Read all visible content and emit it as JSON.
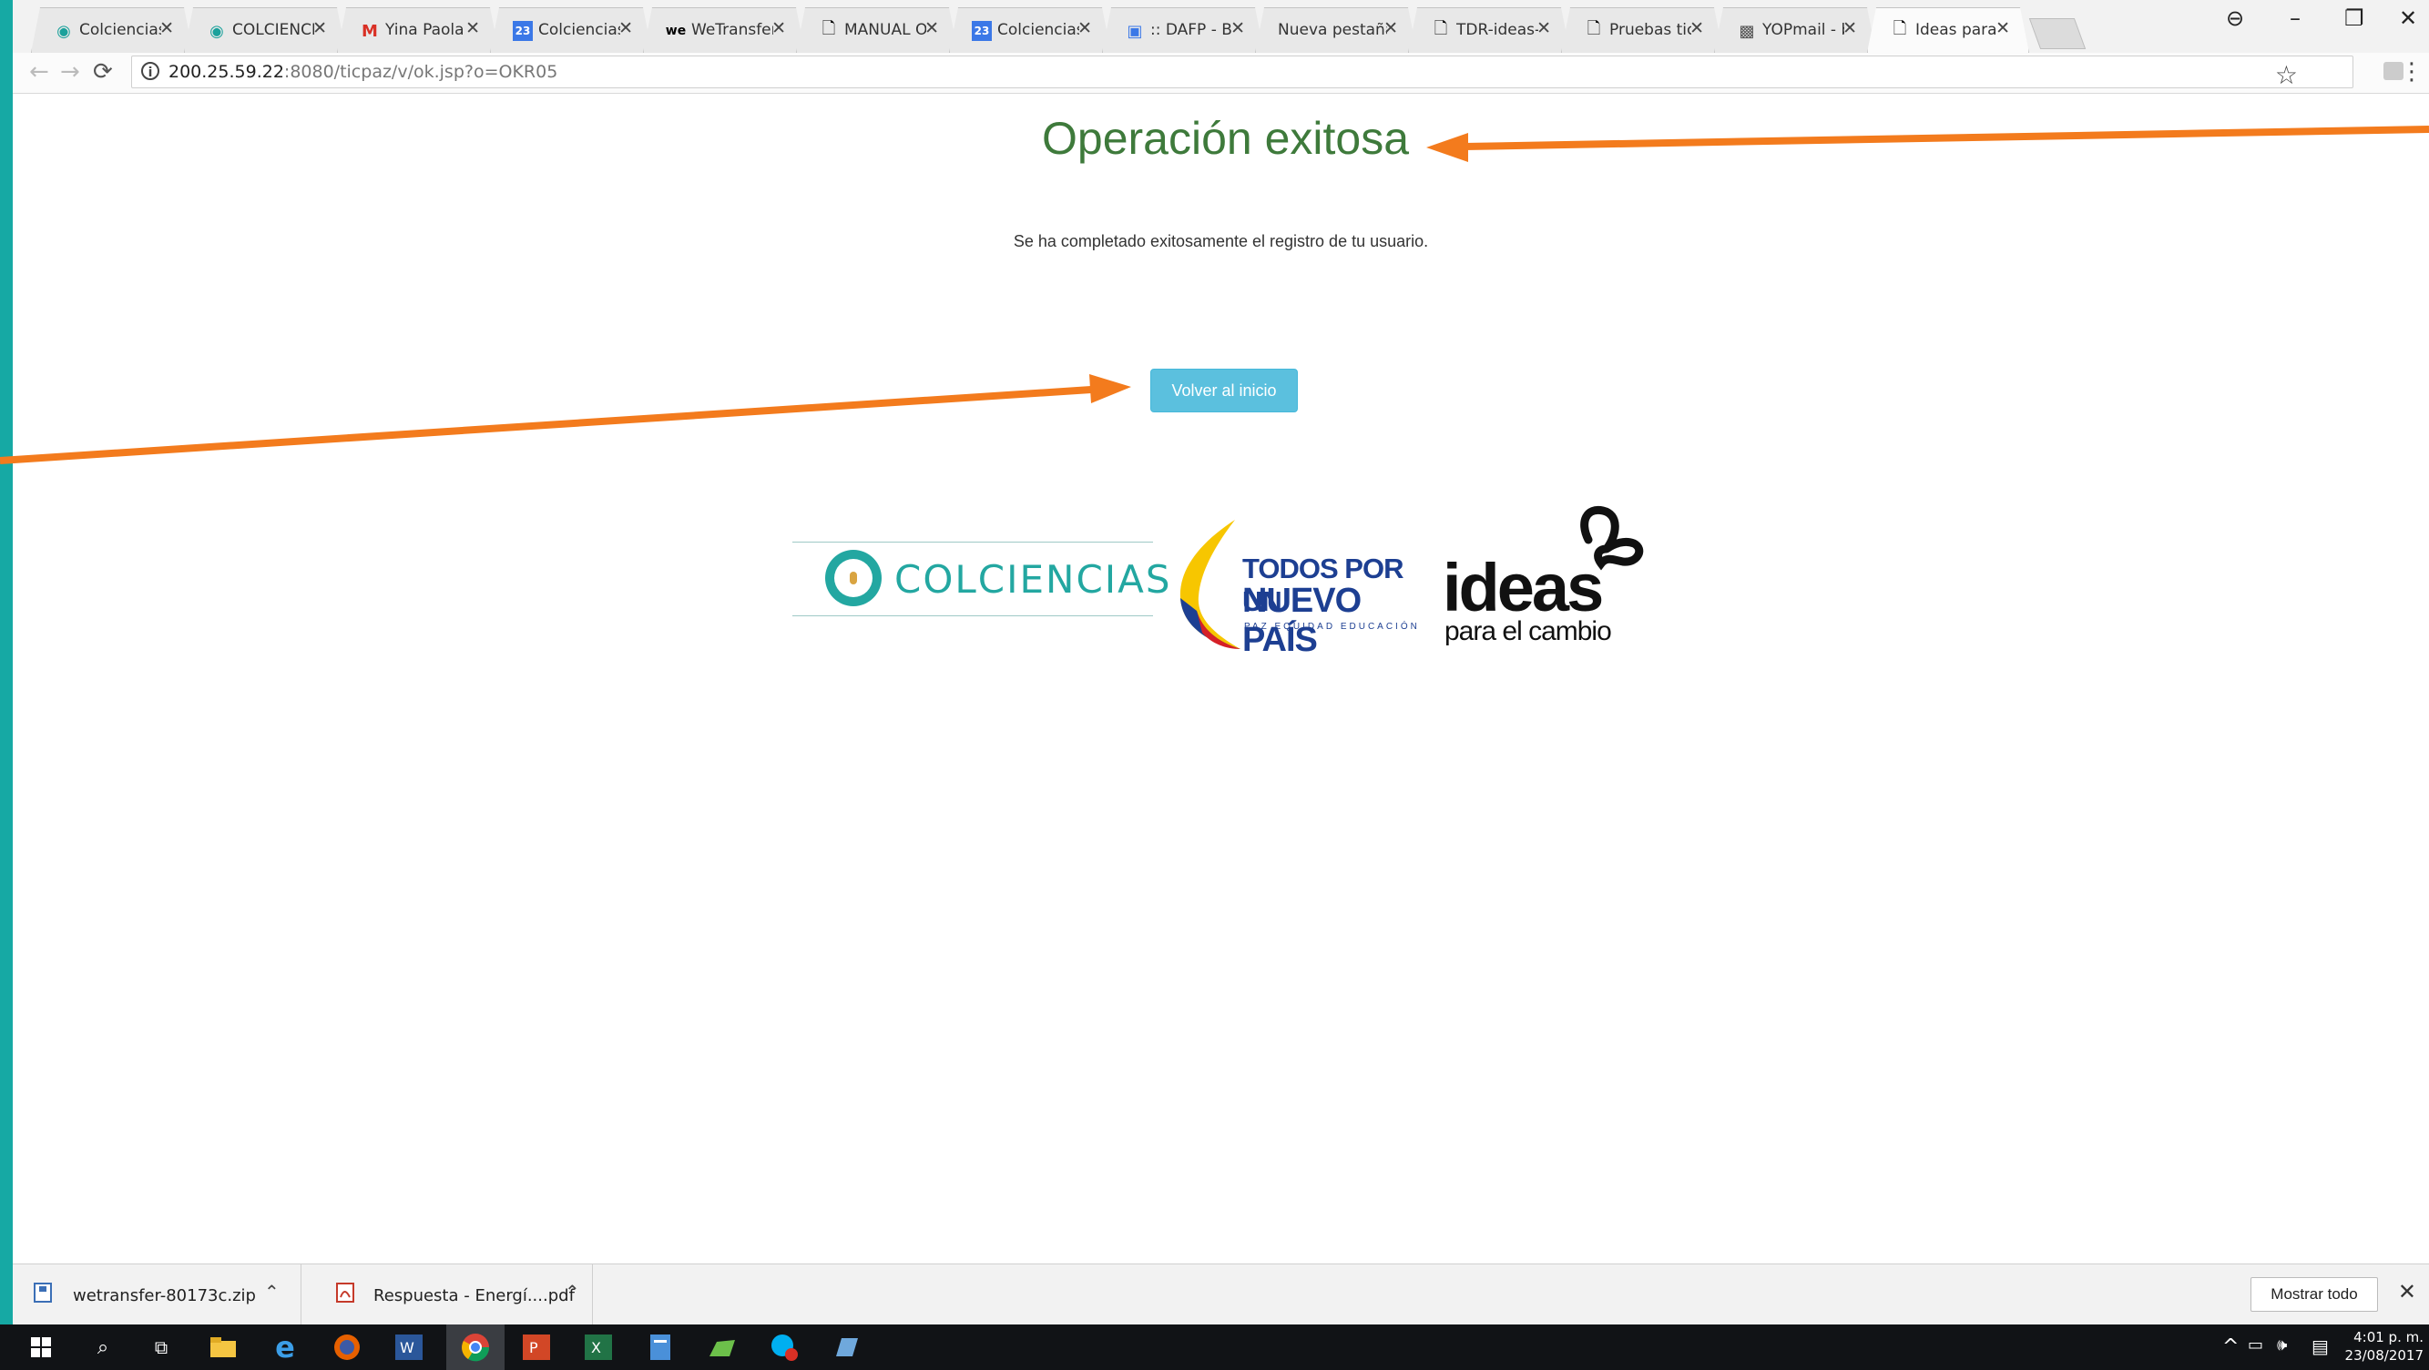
{
  "tabs": [
    {
      "label": "Colciencias",
      "icon": "colciencias-favicon",
      "active": false
    },
    {
      "label": "COLCIENCIAS",
      "icon": "colciencias-favicon",
      "active": false
    },
    {
      "label": "Yina Paola P",
      "icon": "gmail-icon",
      "active": false
    },
    {
      "label": "Colciencias",
      "icon": "calendar-icon",
      "active": false
    },
    {
      "label": "WeTransfer",
      "icon": "wetransfer-icon",
      "active": false
    },
    {
      "label": "MANUAL OF",
      "icon": "page-icon",
      "active": false
    },
    {
      "label": "Colciencias",
      "icon": "calendar-icon",
      "active": false
    },
    {
      "label": ":: DAFP - Ba",
      "icon": "dafp-icon",
      "active": false
    },
    {
      "label": "Nueva pestaña",
      "icon": "",
      "active": false
    },
    {
      "label": "TDR-ideas-p",
      "icon": "page-icon",
      "active": false
    },
    {
      "label": "Pruebas ticp",
      "icon": "page-icon",
      "active": false
    },
    {
      "label": "YOPmail - bo",
      "icon": "yopmail-icon",
      "active": false
    },
    {
      "label": "Ideas para el",
      "icon": "page-icon",
      "active": true
    }
  ],
  "address": {
    "host": "200.25.59.22",
    "rest": ":8080/ticpaz/v/ok.jsp?o=OKR05"
  },
  "page": {
    "title": "Operación exitosa",
    "message": "Se ha completado exitosamente el registro de tu usuario.",
    "button_label": "Volver al inicio"
  },
  "logos": {
    "colciencias": "COLCIENCIAS",
    "todos_line1": "TODOS POR UN",
    "todos_line2": "NUEVO PAÍS",
    "todos_line3": "PAZ  EQUIDAD  EDUCACIÓN",
    "ideas_big": "ideas",
    "ideas_small": "para el cambio"
  },
  "downloads": {
    "items": [
      {
        "name": "wetransfer-80173c.zip",
        "icon": "zip-file-icon"
      },
      {
        "name": "Respuesta - Energí....pdf",
        "icon": "pdf-file-icon"
      }
    ],
    "show_all": "Mostrar todo"
  },
  "taskbar": {
    "time": "4:01 p. m.",
    "date": "23/08/2017"
  },
  "colors": {
    "accent_arrow": "#f37b1d",
    "title_green": "#3e7a3b",
    "button_blue": "#5bc0de",
    "desktop_teal": "#16a9a4"
  }
}
